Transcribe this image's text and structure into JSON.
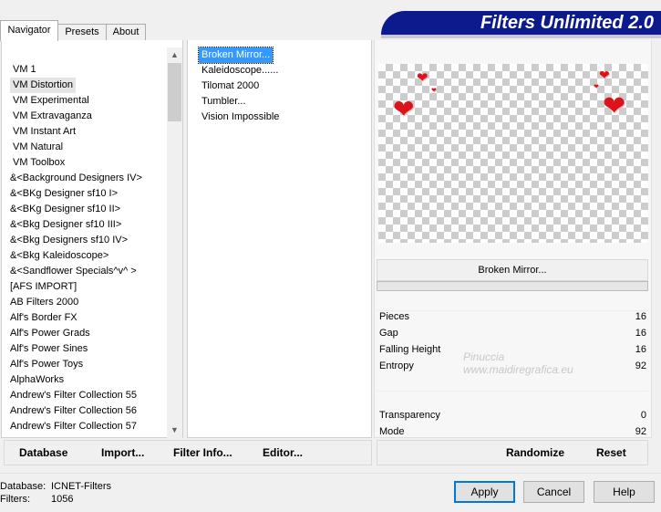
{
  "tabs": [
    {
      "label": "Navigator"
    },
    {
      "label": "Presets"
    },
    {
      "label": "About"
    }
  ],
  "banner": {
    "title": "Filters Unlimited 2.0"
  },
  "categories": [
    "VM 1",
    "VM Distortion",
    "VM Experimental",
    "VM Extravaganza",
    "VM Instant Art",
    "VM Natural",
    "VM Toolbox",
    "&<Background Designers IV>",
    "&<BKg Designer sf10 I>",
    "&<BKg Designer sf10 II>",
    "&<Bkg Designer sf10 III>",
    "&<Bkg Designers sf10 IV>",
    "&<Bkg Kaleidoscope>",
    "&<Sandflower Specials^v^ >",
    "[AFS IMPORT]",
    "AB Filters 2000",
    "Alf's Border FX",
    "Alf's Power Grads",
    "Alf's Power Sines",
    "Alf's Power Toys",
    "AlphaWorks",
    "Andrew's Filter Collection 55",
    "Andrew's Filter Collection 56",
    "Andrew's Filter Collection 57"
  ],
  "filters": [
    "Broken Mirror...",
    "Kaleidoscope......",
    "Tilomat 2000",
    "Tumbler...",
    "Vision Impossible"
  ],
  "current_filter": "Broken Mirror...",
  "params": [
    {
      "label": "Pieces",
      "value": "16"
    },
    {
      "label": "Gap",
      "value": "16"
    },
    {
      "label": "Falling Height",
      "value": "16"
    },
    {
      "label": "Entropy",
      "value": "92"
    },
    {
      "label": "Transparency",
      "value": "0"
    },
    {
      "label": "Mode",
      "value": "92"
    }
  ],
  "watermark": {
    "line1": "Pinuccia",
    "line2": "www.maidiregrafica.eu"
  },
  "toolbar_left": {
    "database": "Database",
    "import": "Import...",
    "filter_info": "Filter Info...",
    "editor": "Editor..."
  },
  "toolbar_right": {
    "randomize": "Randomize",
    "reset": "Reset"
  },
  "status": {
    "db_label": "Database:",
    "db_value": "ICNET-Filters",
    "filters_label": "Filters:",
    "filters_value": "1056"
  },
  "buttons": {
    "apply": "Apply",
    "cancel": "Cancel",
    "help": "Help"
  },
  "colors": {
    "banner": "#0d1a8e",
    "selection": "#3399ff",
    "heart": "#d9141b"
  },
  "icons": {
    "scroll_up": "chevron-up-icon",
    "scroll_down": "chevron-down-icon",
    "heart": "heart-icon"
  }
}
